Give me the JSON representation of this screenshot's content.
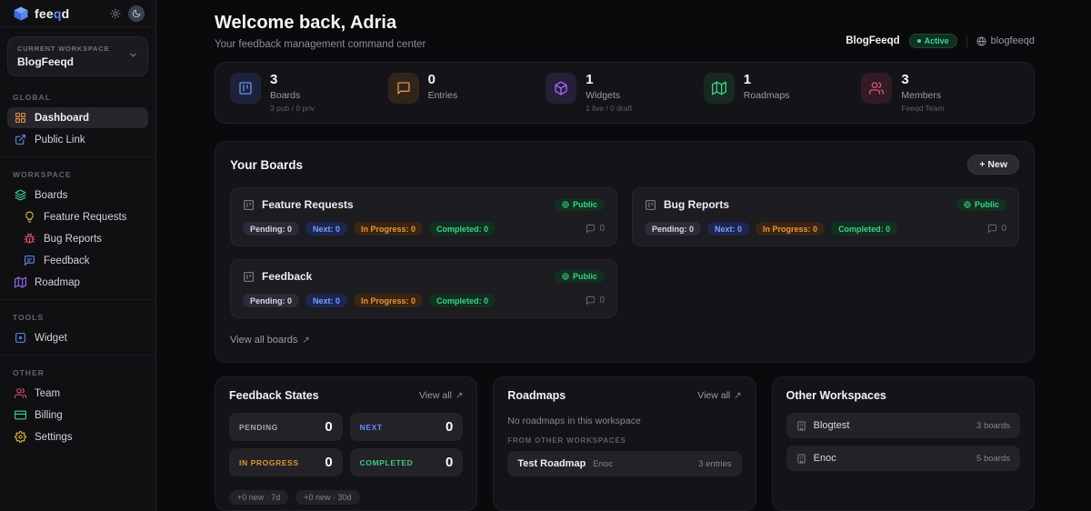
{
  "brand": {
    "pre": "fee",
    "accent": "q",
    "post": "d"
  },
  "palette": {
    "accent_blue": "#5b8def",
    "green": "#3ecf8e",
    "orange": "#e8963a",
    "purple": "#a06bf5",
    "red": "#e05575",
    "yellow": "#e3b33a"
  },
  "sidebar": {
    "workspace": {
      "label": "CURRENT WORKSPACE",
      "value": "BlogFeeqd"
    },
    "global": {
      "label": "GLOBAL",
      "dashboard": "Dashboard",
      "public_link": "Public Link"
    },
    "workspace_section": {
      "label": "WORKSPACE",
      "boards": "Boards",
      "feature_requests": "Feature Requests",
      "bug_reports": "Bug Reports",
      "feedback": "Feedback",
      "roadmap": "Roadmap"
    },
    "tools": {
      "label": "TOOLS",
      "widget": "Widget"
    },
    "other": {
      "label": "OTHER",
      "team": "Team",
      "billing": "Billing",
      "settings": "Settings"
    }
  },
  "header": {
    "title": "Welcome back, Adria",
    "subtitle": "Your feedback management command center",
    "workspace_name": "BlogFeeqd",
    "status": "Active",
    "domain": "blogfeeqd"
  },
  "stats": [
    {
      "value": "3",
      "label": "Boards",
      "sub": "3 pub / 0 priv"
    },
    {
      "value": "0",
      "label": "Entries",
      "sub": ""
    },
    {
      "value": "1",
      "label": "Widgets",
      "sub": "1 live / 0 draft"
    },
    {
      "value": "1",
      "label": "Roadmaps",
      "sub": ""
    },
    {
      "value": "3",
      "label": "Members",
      "sub": "Feeqd Team"
    }
  ],
  "boards_section": {
    "title": "Your Boards",
    "new_button": "+ New",
    "view_all": "View all boards",
    "cards": [
      {
        "name": "Feature Requests",
        "visibility": "Public",
        "pending": "Pending: 0",
        "next": "Next: 0",
        "in_progress": "In Progress: 0",
        "completed": "Completed: 0",
        "comments": "0"
      },
      {
        "name": "Bug Reports",
        "visibility": "Public",
        "pending": "Pending: 0",
        "next": "Next: 0",
        "in_progress": "In Progress: 0",
        "completed": "Completed: 0",
        "comments": "0"
      },
      {
        "name": "Feedback",
        "visibility": "Public",
        "pending": "Pending: 0",
        "next": "Next: 0",
        "in_progress": "In Progress: 0",
        "completed": "Completed: 0",
        "comments": "0"
      }
    ]
  },
  "feedback_states": {
    "title": "Feedback States",
    "view_all": "View all",
    "states": [
      {
        "label": "PENDING",
        "value": "0"
      },
      {
        "label": "NEXT",
        "value": "0"
      },
      {
        "label": "IN PROGRESS",
        "value": "0"
      },
      {
        "label": "COMPLETED",
        "value": "0"
      }
    ],
    "pills": [
      "+0 new · 7d",
      "+0 new · 30d"
    ]
  },
  "roadmaps_panel": {
    "title": "Roadmaps",
    "view_all": "View all",
    "empty": "No roadmaps in this workspace",
    "from_other": "FROM OTHER WORKSPACES",
    "items": [
      {
        "name": "Test Roadmap",
        "workspace": "Enoc",
        "entries": "3 entries"
      }
    ]
  },
  "other_workspaces": {
    "title": "Other Workspaces",
    "items": [
      {
        "name": "Blogtest",
        "boards": "3 boards"
      },
      {
        "name": "Enoc",
        "boards": "5 boards"
      }
    ]
  }
}
